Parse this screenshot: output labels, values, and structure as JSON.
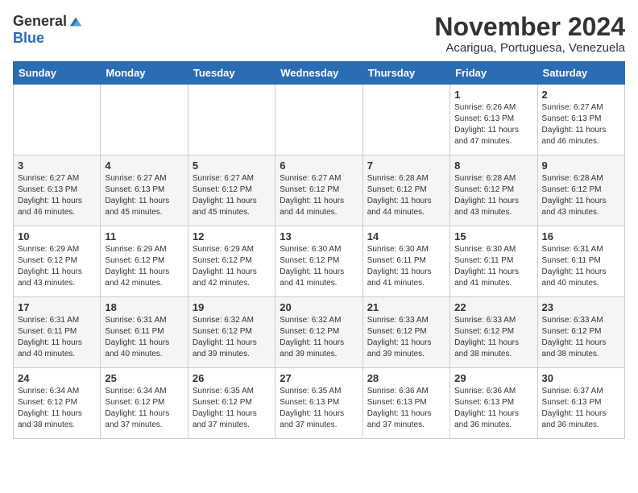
{
  "header": {
    "logo_general": "General",
    "logo_blue": "Blue",
    "month": "November 2024",
    "location": "Acarigua, Portuguesa, Venezuela"
  },
  "days_of_week": [
    "Sunday",
    "Monday",
    "Tuesday",
    "Wednesday",
    "Thursday",
    "Friday",
    "Saturday"
  ],
  "weeks": [
    [
      {
        "day": "",
        "info": ""
      },
      {
        "day": "",
        "info": ""
      },
      {
        "day": "",
        "info": ""
      },
      {
        "day": "",
        "info": ""
      },
      {
        "day": "",
        "info": ""
      },
      {
        "day": "1",
        "info": "Sunrise: 6:26 AM\nSunset: 6:13 PM\nDaylight: 11 hours\nand 47 minutes."
      },
      {
        "day": "2",
        "info": "Sunrise: 6:27 AM\nSunset: 6:13 PM\nDaylight: 11 hours\nand 46 minutes."
      }
    ],
    [
      {
        "day": "3",
        "info": "Sunrise: 6:27 AM\nSunset: 6:13 PM\nDaylight: 11 hours\nand 46 minutes."
      },
      {
        "day": "4",
        "info": "Sunrise: 6:27 AM\nSunset: 6:13 PM\nDaylight: 11 hours\nand 45 minutes."
      },
      {
        "day": "5",
        "info": "Sunrise: 6:27 AM\nSunset: 6:12 PM\nDaylight: 11 hours\nand 45 minutes."
      },
      {
        "day": "6",
        "info": "Sunrise: 6:27 AM\nSunset: 6:12 PM\nDaylight: 11 hours\nand 44 minutes."
      },
      {
        "day": "7",
        "info": "Sunrise: 6:28 AM\nSunset: 6:12 PM\nDaylight: 11 hours\nand 44 minutes."
      },
      {
        "day": "8",
        "info": "Sunrise: 6:28 AM\nSunset: 6:12 PM\nDaylight: 11 hours\nand 43 minutes."
      },
      {
        "day": "9",
        "info": "Sunrise: 6:28 AM\nSunset: 6:12 PM\nDaylight: 11 hours\nand 43 minutes."
      }
    ],
    [
      {
        "day": "10",
        "info": "Sunrise: 6:29 AM\nSunset: 6:12 PM\nDaylight: 11 hours\nand 43 minutes."
      },
      {
        "day": "11",
        "info": "Sunrise: 6:29 AM\nSunset: 6:12 PM\nDaylight: 11 hours\nand 42 minutes."
      },
      {
        "day": "12",
        "info": "Sunrise: 6:29 AM\nSunset: 6:12 PM\nDaylight: 11 hours\nand 42 minutes."
      },
      {
        "day": "13",
        "info": "Sunrise: 6:30 AM\nSunset: 6:12 PM\nDaylight: 11 hours\nand 41 minutes."
      },
      {
        "day": "14",
        "info": "Sunrise: 6:30 AM\nSunset: 6:11 PM\nDaylight: 11 hours\nand 41 minutes."
      },
      {
        "day": "15",
        "info": "Sunrise: 6:30 AM\nSunset: 6:11 PM\nDaylight: 11 hours\nand 41 minutes."
      },
      {
        "day": "16",
        "info": "Sunrise: 6:31 AM\nSunset: 6:11 PM\nDaylight: 11 hours\nand 40 minutes."
      }
    ],
    [
      {
        "day": "17",
        "info": "Sunrise: 6:31 AM\nSunset: 6:11 PM\nDaylight: 11 hours\nand 40 minutes."
      },
      {
        "day": "18",
        "info": "Sunrise: 6:31 AM\nSunset: 6:11 PM\nDaylight: 11 hours\nand 40 minutes."
      },
      {
        "day": "19",
        "info": "Sunrise: 6:32 AM\nSunset: 6:12 PM\nDaylight: 11 hours\nand 39 minutes."
      },
      {
        "day": "20",
        "info": "Sunrise: 6:32 AM\nSunset: 6:12 PM\nDaylight: 11 hours\nand 39 minutes."
      },
      {
        "day": "21",
        "info": "Sunrise: 6:33 AM\nSunset: 6:12 PM\nDaylight: 11 hours\nand 39 minutes."
      },
      {
        "day": "22",
        "info": "Sunrise: 6:33 AM\nSunset: 6:12 PM\nDaylight: 11 hours\nand 38 minutes."
      },
      {
        "day": "23",
        "info": "Sunrise: 6:33 AM\nSunset: 6:12 PM\nDaylight: 11 hours\nand 38 minutes."
      }
    ],
    [
      {
        "day": "24",
        "info": "Sunrise: 6:34 AM\nSunset: 6:12 PM\nDaylight: 11 hours\nand 38 minutes."
      },
      {
        "day": "25",
        "info": "Sunrise: 6:34 AM\nSunset: 6:12 PM\nDaylight: 11 hours\nand 37 minutes."
      },
      {
        "day": "26",
        "info": "Sunrise: 6:35 AM\nSunset: 6:12 PM\nDaylight: 11 hours\nand 37 minutes."
      },
      {
        "day": "27",
        "info": "Sunrise: 6:35 AM\nSunset: 6:13 PM\nDaylight: 11 hours\nand 37 minutes."
      },
      {
        "day": "28",
        "info": "Sunrise: 6:36 AM\nSunset: 6:13 PM\nDaylight: 11 hours\nand 37 minutes."
      },
      {
        "day": "29",
        "info": "Sunrise: 6:36 AM\nSunset: 6:13 PM\nDaylight: 11 hours\nand 36 minutes."
      },
      {
        "day": "30",
        "info": "Sunrise: 6:37 AM\nSunset: 6:13 PM\nDaylight: 11 hours\nand 36 minutes."
      }
    ]
  ]
}
